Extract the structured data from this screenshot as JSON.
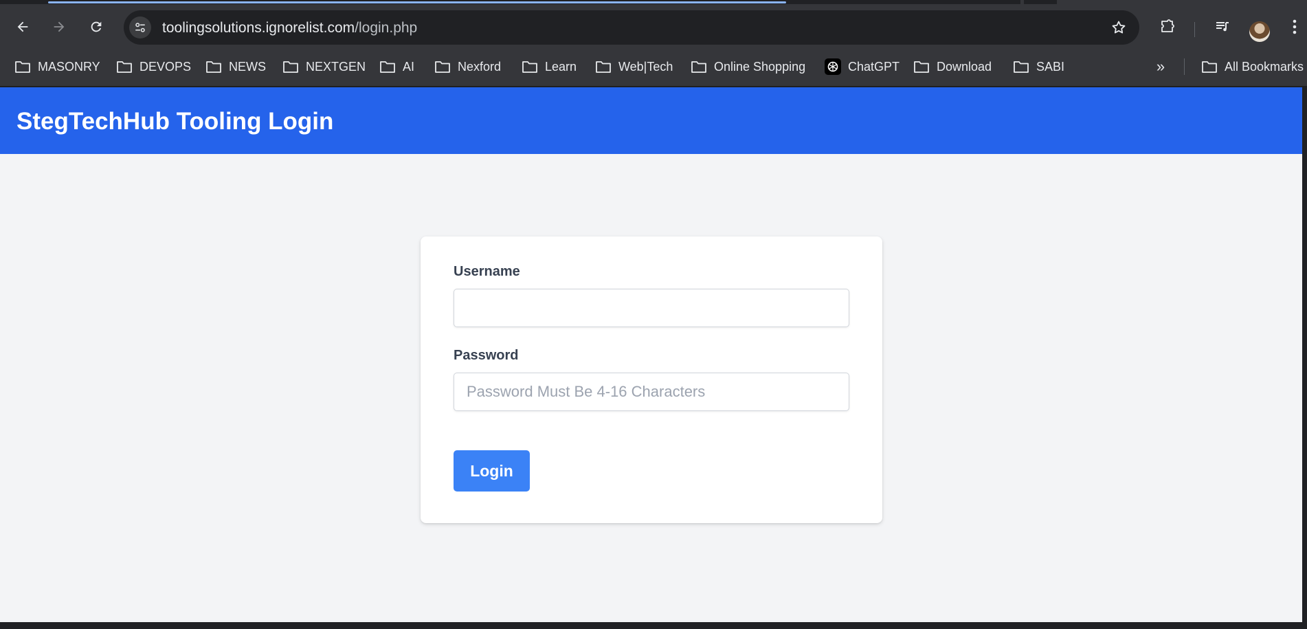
{
  "browser": {
    "url_host": "toolingsolutions.ignorelist.com",
    "url_path": "/login.php",
    "bookmarks": [
      {
        "label": "MASONRY",
        "icon": "folder-icon"
      },
      {
        "label": "DEVOPS",
        "icon": "folder-icon"
      },
      {
        "label": "NEWS",
        "icon": "folder-icon"
      },
      {
        "label": "NEXTGEN",
        "icon": "folder-icon"
      },
      {
        "label": "AI",
        "icon": "folder-icon"
      },
      {
        "label": "Nexford",
        "icon": "folder-icon"
      },
      {
        "label": "Learn",
        "icon": "folder-icon"
      },
      {
        "label": "Web|Tech",
        "icon": "folder-icon"
      },
      {
        "label": "Online Shopping",
        "icon": "folder-icon"
      },
      {
        "label": "ChatGPT",
        "icon": "chatgpt-icon"
      },
      {
        "label": "Download",
        "icon": "folder-icon"
      },
      {
        "label": "SABI",
        "icon": "folder-icon"
      }
    ],
    "all_bookmarks_label": "All Bookmarks",
    "overflow_label": "»"
  },
  "page": {
    "header_title": "StegTechHub Tooling Login",
    "username_label": "Username",
    "username_value": "",
    "password_label": "Password",
    "password_placeholder": "Password Must Be 4-16 Characters",
    "login_button": "Login"
  },
  "colors": {
    "header_bg": "#2563eb",
    "button_bg": "#3b82f6",
    "page_bg": "#f3f4f6"
  }
}
